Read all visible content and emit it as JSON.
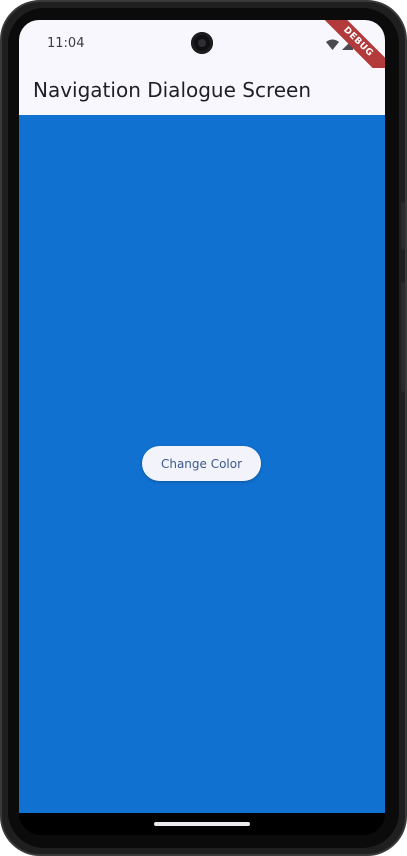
{
  "status_bar": {
    "time": "11:04",
    "icons": [
      "wifi-icon",
      "signal-icon",
      "battery-icon"
    ]
  },
  "debug_banner": "DEBUG",
  "app_bar": {
    "title": "Navigation Dialogue Screen"
  },
  "body": {
    "background_color": "#1171d1",
    "button_label": "Change Color"
  },
  "colors": {
    "app_bar_bg": "#f7f7fd",
    "button_bg": "#f3f3fb",
    "button_text": "#3d5a8a",
    "debug_banner": "#b23a3a"
  }
}
